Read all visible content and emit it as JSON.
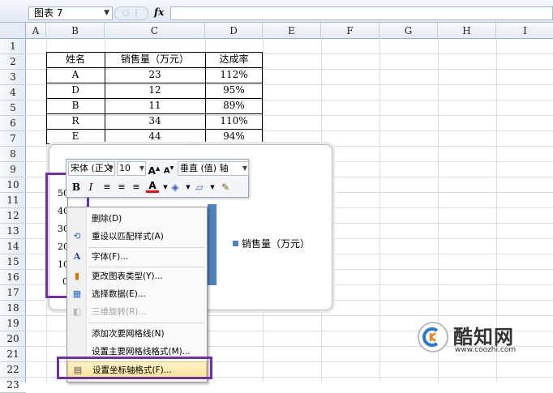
{
  "formula_bar": {
    "name_box": "图表 7",
    "fx_label": "fx",
    "formula": ""
  },
  "columns": [
    "A",
    "B",
    "C",
    "D",
    "E",
    "F",
    "G",
    "H",
    "I"
  ],
  "rows": [
    "1",
    "2",
    "3",
    "4",
    "5",
    "6",
    "7",
    "8",
    "9",
    "10",
    "11",
    "12",
    "13",
    "14",
    "15",
    "16",
    "17",
    "18",
    "19",
    "20",
    "21",
    "22",
    "23"
  ],
  "table": {
    "headers": [
      "姓名",
      "销售量（万元）",
      "达成率"
    ],
    "rows": [
      [
        "A",
        "23",
        "112%"
      ],
      [
        "D",
        "12",
        "95%"
      ],
      [
        "B",
        "11",
        "89%"
      ],
      [
        "R",
        "34",
        "110%"
      ],
      [
        "E",
        "44",
        "94%"
      ]
    ]
  },
  "chart": {
    "legend": "销售量（万元）",
    "axis_labels": [
      "50",
      "40",
      "30",
      "20",
      "10",
      "0"
    ],
    "bar_color": "#4f81bd"
  },
  "mini_toolbar": {
    "font_name": "宋体 (正文",
    "font_size": "10",
    "element": "垂直 (值) 轴",
    "grow_font": "A",
    "shrink_font": "A",
    "bold": "B",
    "italic": "I",
    "font_color_letter": "A"
  },
  "context_menu": {
    "items": [
      {
        "label": "删除(D)",
        "icon": "none",
        "disabled": false
      },
      {
        "label": "重设以匹配样式(A)",
        "icon": "reset-style-icon",
        "disabled": false
      },
      {
        "label": "字体(F)...",
        "icon": "font-icon",
        "disabled": false
      },
      {
        "label": "更改图表类型(Y)...",
        "icon": "chart-type-icon",
        "disabled": false
      },
      {
        "label": "选择数据(E)...",
        "icon": "select-data-icon",
        "disabled": false
      },
      {
        "label": "三维旋转(R)...",
        "icon": "rotate-3d-icon",
        "disabled": true
      },
      {
        "label": "添加次要网格线(N)",
        "icon": "none",
        "disabled": false
      },
      {
        "label": "设置主要网格线格式(M)...",
        "icon": "none",
        "disabled": false
      },
      {
        "label": "设置坐标轴格式(F)...",
        "icon": "format-axis-icon",
        "disabled": false
      }
    ]
  },
  "watermark": {
    "name": "酷知网",
    "url": "www.coozhi.com"
  },
  "colors": {
    "accent_highlight": "#7030a0",
    "series": "#4f81bd",
    "menu_hover": "#fae39d"
  }
}
